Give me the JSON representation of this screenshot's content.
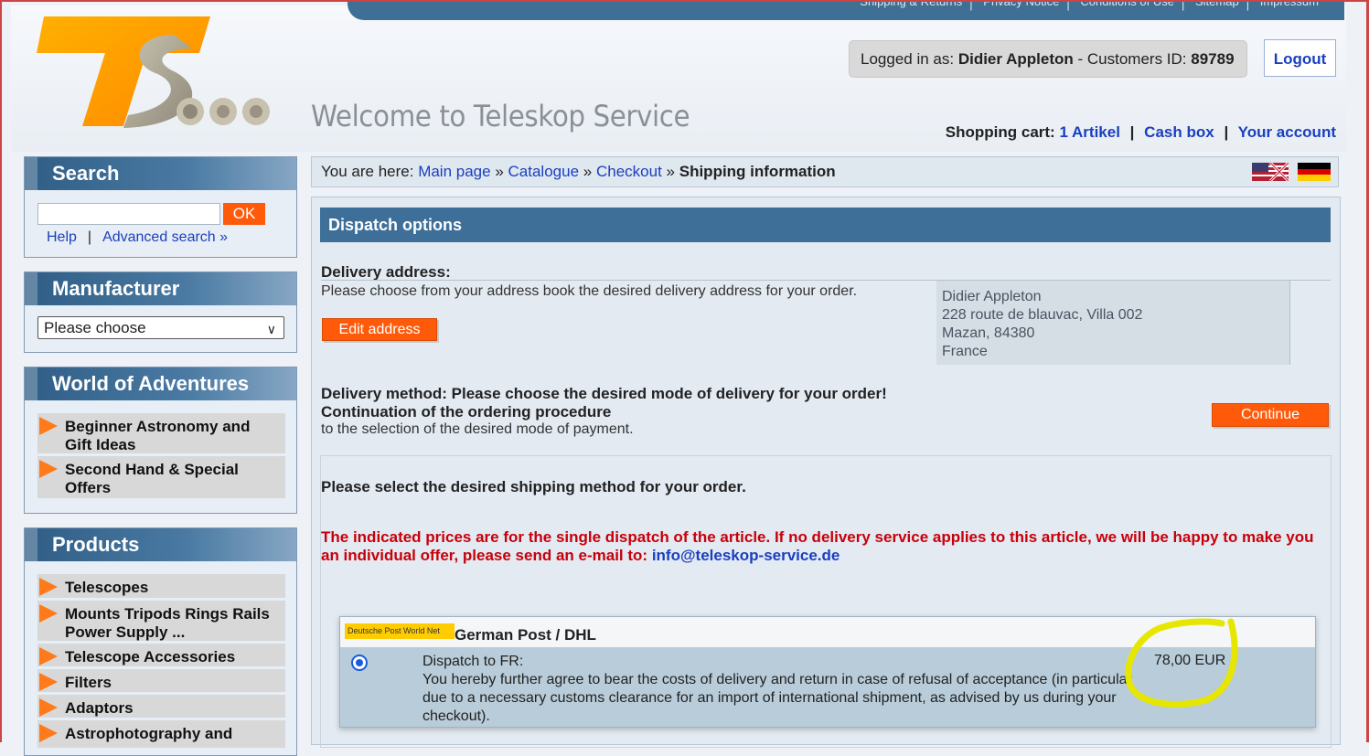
{
  "topnav": [
    "Shipping & Returns",
    "Privacy Notice",
    "Conditions of Use",
    "Sitemap",
    "Impressum"
  ],
  "header": {
    "welcome": "Welcome to Teleskop Service",
    "login_prefix": "Logged in as:",
    "user_name": "Didier Appleton",
    "customer_prefix": "- Customers ID:",
    "customer_id": "89789",
    "logout": "Logout",
    "cart_label": "Shopping cart:",
    "cart_items": "1 Artikel",
    "cash_box": "Cash box",
    "your_account": "Your account",
    "separator": "|"
  },
  "sidebar": {
    "search": {
      "title": "Search",
      "ok": "OK",
      "help": "Help",
      "bar": "|",
      "advanced": "Advanced search »"
    },
    "manufacturer": {
      "title": "Manufacturer",
      "selected": "Please choose"
    },
    "adventures": {
      "title": "World of Adventures",
      "items": [
        "Beginner Astronomy and Gift Ideas",
        "Second Hand & Special Offers"
      ]
    },
    "products": {
      "title": "Products",
      "items": [
        "Telescopes",
        "Mounts Tripods Rings Rails Power Supply ...",
        "Telescope Accessories",
        "Filters",
        "Adaptors",
        "Astrophotography and"
      ]
    }
  },
  "breadcrumb": {
    "prefix": "You are here:",
    "items": [
      "Main page",
      "Catalogue",
      "Checkout"
    ],
    "sep": "»",
    "current": "Shipping information"
  },
  "main": {
    "title": "Dispatch options",
    "delivery_address_label": "Delivery address:",
    "delivery_address_text": "Please choose from your address book the desired delivery address for your order.",
    "edit_address": "Edit address",
    "address": [
      "Didier Appleton",
      "228 route de blauvac, Villa 002",
      "Mazan, 84380",
      "France"
    ],
    "delivery_method": "Delivery method: Please choose the desired mode of delivery for your order!",
    "continuation_label": "Continuation of the ordering procedure",
    "continuation_text": "to the selection of the desired mode of payment.",
    "continue": "Continue",
    "select_prompt": "Please select the desired shipping method for your order.",
    "note": "The indicated prices are for the single dispatch of the article. If no delivery service applies to this article, we will be happy to make you an individual offer, please send an e-mail to:",
    "note_email": "info@teleskop-service.de",
    "shipping": {
      "logo_text": "Deutsche Post  World Net",
      "name": "German Post / DHL",
      "dispatch_to": "Dispatch to FR:",
      "description": "You hereby further agree to bear the costs of delivery and return in case of refusal of acceptance (in particular due to a necessary customs clearance for an import of international shipment, as advised by us during your checkout).",
      "price": "78,00 EUR"
    }
  },
  "colors": {
    "accent": "#ff5a0a",
    "header_blue": "#3e6f98",
    "link": "#1a3fbf",
    "note_red": "#c8000a",
    "highlight": "#e6e600"
  }
}
